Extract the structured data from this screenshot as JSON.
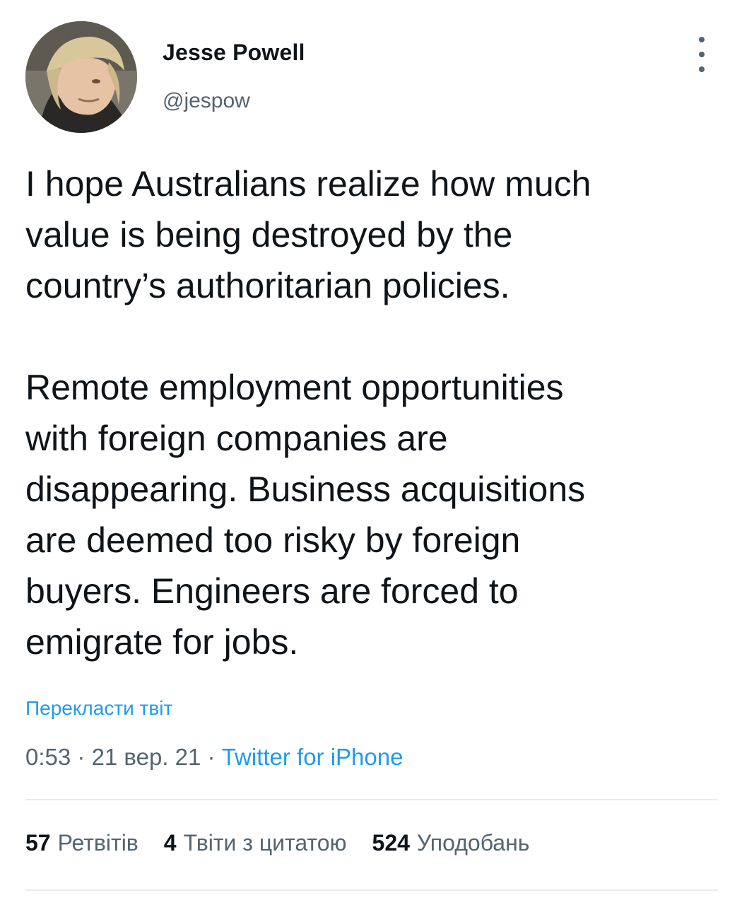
{
  "user": {
    "display_name": "Jesse Powell",
    "handle": "@jespow",
    "avatar": "profile-photo"
  },
  "tweet": {
    "text": "I hope Australians realize how much\nvalue is being destroyed by the\ncountry’s authoritarian policies.\n\nRemote employment opportunities\nwith foreign companies are\ndisappearing. Business acquisitions\nare deemed too risky by foreign\nbuyers. Engineers are forced to\nemigrate for jobs.",
    "translate_label": "Перекласти твіт"
  },
  "meta": {
    "time": "0:53",
    "separator": " · ",
    "date": "21 вер. 21",
    "source": "Twitter for iPhone"
  },
  "stats": {
    "retweets_count": "57",
    "retweets_label": "Ретвітів",
    "quotes_count": "4",
    "quotes_label": "Твіти з цитатою",
    "likes_count": "524",
    "likes_label": "Уподобань"
  },
  "icons": {
    "more": "more-vertical-icon"
  },
  "colors": {
    "text": "#0f1419",
    "secondary": "#536471",
    "link": "#1d9bf0",
    "divider": "#e6ecf0"
  }
}
